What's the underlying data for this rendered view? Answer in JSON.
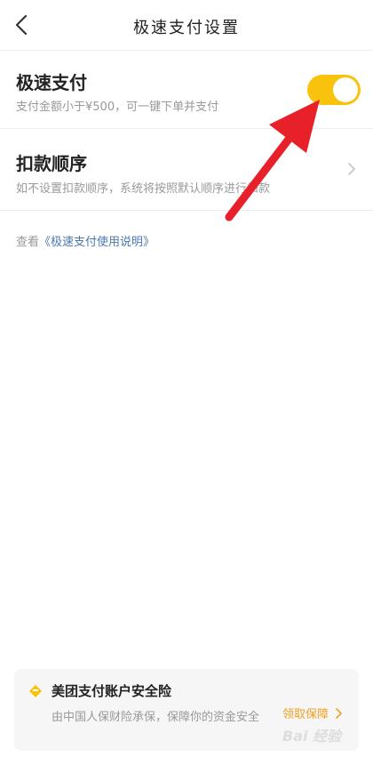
{
  "header": {
    "title": "极速支付设置"
  },
  "fast_pay": {
    "title": "极速支付",
    "description": "支付金额小于¥500，可一键下单并支付",
    "toggle_on": true
  },
  "deduct_order": {
    "title": "扣款顺序",
    "description": "如不设置扣款顺序，系统将按照默认顺序进行扣款"
  },
  "help": {
    "prefix": "查看",
    "link_text": "《极速支付使用说明》"
  },
  "insurance_card": {
    "title": "美团支付账户安全险",
    "description": "由中国人保财险承保，保障你的资金安全",
    "action_label": "领取保障"
  },
  "watermark": "Bai 经验",
  "colors": {
    "accent_yellow": "#f9c30d",
    "action_orange": "#f0a020",
    "link_blue": "#4a78b0",
    "annotation_red": "#e8202a"
  }
}
